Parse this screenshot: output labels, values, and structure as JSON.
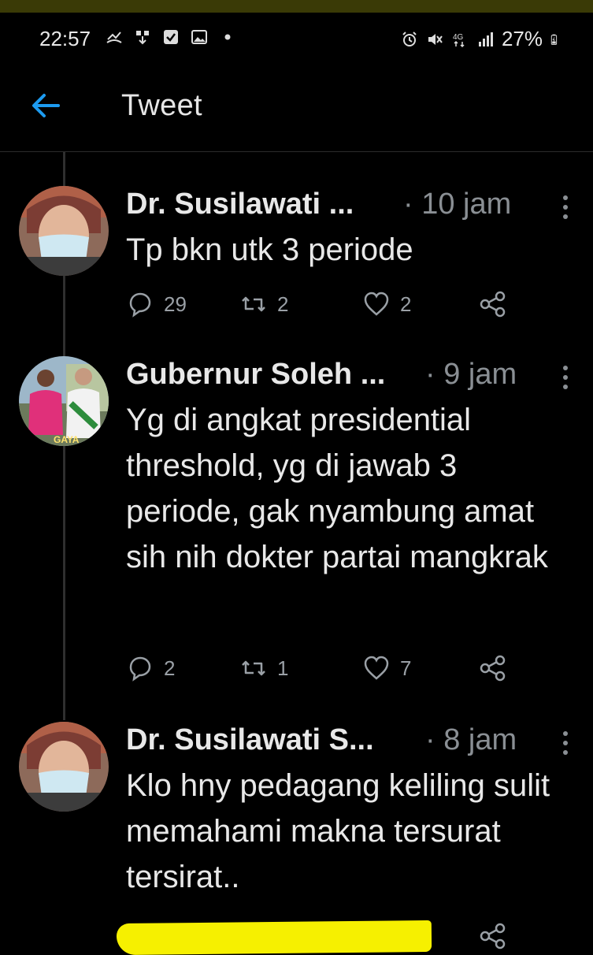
{
  "status_bar": {
    "time": "22:57",
    "left_icons": [
      "missed-call-icon",
      "download-icon",
      "checkbox-icon",
      "image-icon",
      "dot-icon"
    ],
    "right_icons": [
      "alarm-icon",
      "mute-icon",
      "4g-icon",
      "signal-icon"
    ],
    "battery_text": "27%"
  },
  "app_bar": {
    "title": "Tweet",
    "back_icon": "arrow-left-icon"
  },
  "tweets": [
    {
      "name": "Dr. Susilawati ...",
      "time": "· 10 jam",
      "text": "Tp bkn utk 3 periode",
      "replies": "29",
      "retweets": "2",
      "likes": "2"
    },
    {
      "name": "Gubernur Soleh ...",
      "time": "· 9 jam",
      "text": "Yg di angkat presidential threshold, yg di jawab 3 periode, gak nyambung amat sih nih dokter partai mangkrak",
      "replies": "2",
      "retweets": "1",
      "likes": "7",
      "avatar_label": "GAYA"
    },
    {
      "name": "Dr. Susilawati S...",
      "time": "· 8 jam",
      "text": "Klo hny pedagang keliling sulit memahami makna tersurat tersirat.."
    }
  ],
  "colors": {
    "accent": "#1d9bf0",
    "background": "#000000",
    "highlight": "#f6f000",
    "muted": "#8a8f94"
  }
}
